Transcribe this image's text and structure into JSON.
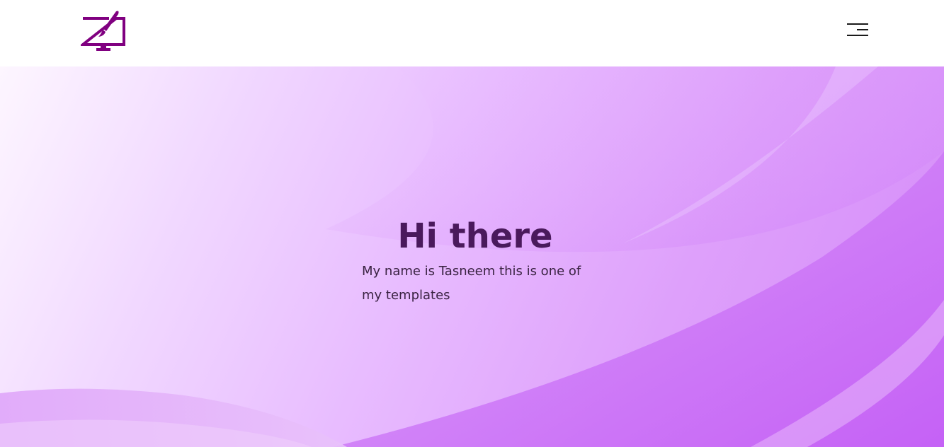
{
  "header": {
    "logo_icon": "monitor-paintbrush-icon",
    "menu_icon": "hamburger-menu-icon",
    "brand_color": "#800080"
  },
  "hero": {
    "title": "Hi there",
    "subtitle": "My name is Tasneem this is one of my templates",
    "title_color": "#4a1a5c",
    "gradient_colors": [
      "#fdf6ff",
      "#e8bcff",
      "#d48af8",
      "#c25af5"
    ]
  }
}
